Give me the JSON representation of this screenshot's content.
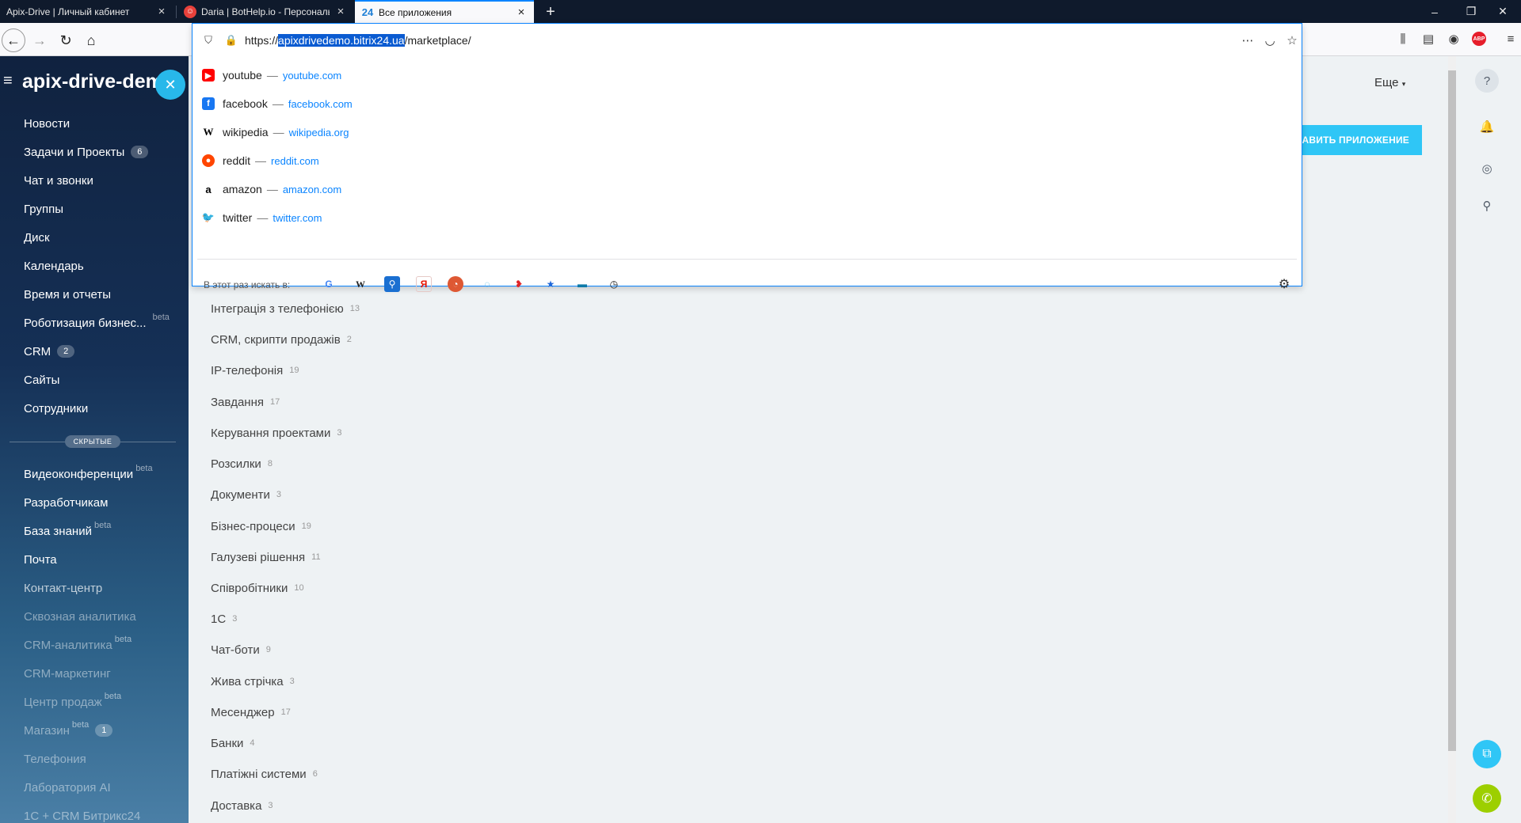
{
  "browser": {
    "tabs": [
      {
        "label": "Apix-Drive | Личный кабинет",
        "favicon": "apix-drive"
      },
      {
        "label": "Daria | BotHelp.io - Персональ",
        "favicon": "bothelp"
      },
      {
        "label": "Все приложения",
        "favicon": "bitrix24",
        "favicon_text": "24"
      }
    ],
    "new_tab_label": "+",
    "url": {
      "prefix": "https://",
      "host": "apixdrivedemo.bitrix24.ua",
      "path": "/marketplace/"
    },
    "suggestions": [
      {
        "title": "youtube",
        "url": "youtube.com",
        "icon": "youtube-icon",
        "color": "#ff0000"
      },
      {
        "title": "facebook",
        "url": "facebook.com",
        "icon": "facebook-icon",
        "color": "#1877f2"
      },
      {
        "title": "wikipedia",
        "url": "wikipedia.org",
        "icon": "wikipedia-icon",
        "color": "#000000"
      },
      {
        "title": "reddit",
        "url": "reddit.com",
        "icon": "reddit-icon",
        "color": "#ff4500"
      },
      {
        "title": "amazon",
        "url": "amazon.com",
        "icon": "amazon-icon",
        "color": "#000000"
      },
      {
        "title": "twitter",
        "url": "twitter.com",
        "icon": "twitter-icon",
        "color": "#1da1f2"
      }
    ],
    "search_label": "В этот раз искать в:",
    "search_engines": [
      "google",
      "wikipedia",
      "search",
      "yandex",
      "duckduckgo",
      "eco",
      "ozon",
      "bookmarks",
      "tabs",
      "history"
    ],
    "accent": "#0a84ff"
  },
  "sidebar": {
    "title": "apix-drive-dem",
    "items": [
      {
        "label": "Новости"
      },
      {
        "label": "Задачи и Проекты",
        "badge": "6"
      },
      {
        "label": "Чат и звонки"
      },
      {
        "label": "Группы"
      },
      {
        "label": "Диск"
      },
      {
        "label": "Календарь"
      },
      {
        "label": "Время и отчеты"
      },
      {
        "label": "Роботизация бизнес...",
        "beta": "beta"
      },
      {
        "label": "CRM",
        "badge": "2"
      },
      {
        "label": "Сайты"
      },
      {
        "label": "Сотрудники"
      }
    ],
    "hidden_label": "СКРЫТЫЕ",
    "hidden_items": [
      {
        "label": "Видеоконференции",
        "beta": "beta"
      },
      {
        "label": "Разработчикам"
      },
      {
        "label": "База знаний",
        "beta": "beta"
      },
      {
        "label": "Почта"
      },
      {
        "label": "Контакт-центр"
      },
      {
        "label": "Сквозная аналитика"
      },
      {
        "label": "CRM-аналитика",
        "beta": "beta"
      },
      {
        "label": "CRM-маркетинг"
      },
      {
        "label": "Центр продаж",
        "beta": "beta"
      },
      {
        "label": "Магазин",
        "beta": "beta",
        "badge": "1"
      },
      {
        "label": "Телефония"
      },
      {
        "label": "Лаборатория AI"
      },
      {
        "label": "1С + CRM Битрикс24"
      }
    ]
  },
  "main": {
    "more_label": "Еще",
    "add_app_label": "АВИТЬ ПРИЛОЖЕНИЕ",
    "categories": [
      {
        "name": "Інтеграція з телефонією",
        "count": "13"
      },
      {
        "name": "CRM, скрипти продажів",
        "count": "2"
      },
      {
        "name": "IP-телефонія",
        "count": "19"
      },
      {
        "name": "Завдання",
        "count": "17"
      },
      {
        "name": "Керування проектами",
        "count": "3"
      },
      {
        "name": "Розсилки",
        "count": "8"
      },
      {
        "name": "Документи",
        "count": "3"
      },
      {
        "name": "Бізнес-процеси",
        "count": "19"
      },
      {
        "name": "Галузеві рішення",
        "count": "11"
      },
      {
        "name": "Співробітники",
        "count": "10"
      },
      {
        "name": "1С",
        "count": "3"
      },
      {
        "name": "Чат-боти",
        "count": "9"
      },
      {
        "name": "Жива стрічка",
        "count": "3"
      },
      {
        "name": "Месенджер",
        "count": "17"
      },
      {
        "name": "Банки",
        "count": "4"
      },
      {
        "name": "Платіжні системи",
        "count": "6"
      },
      {
        "name": "Доставка",
        "count": "3"
      }
    ]
  }
}
